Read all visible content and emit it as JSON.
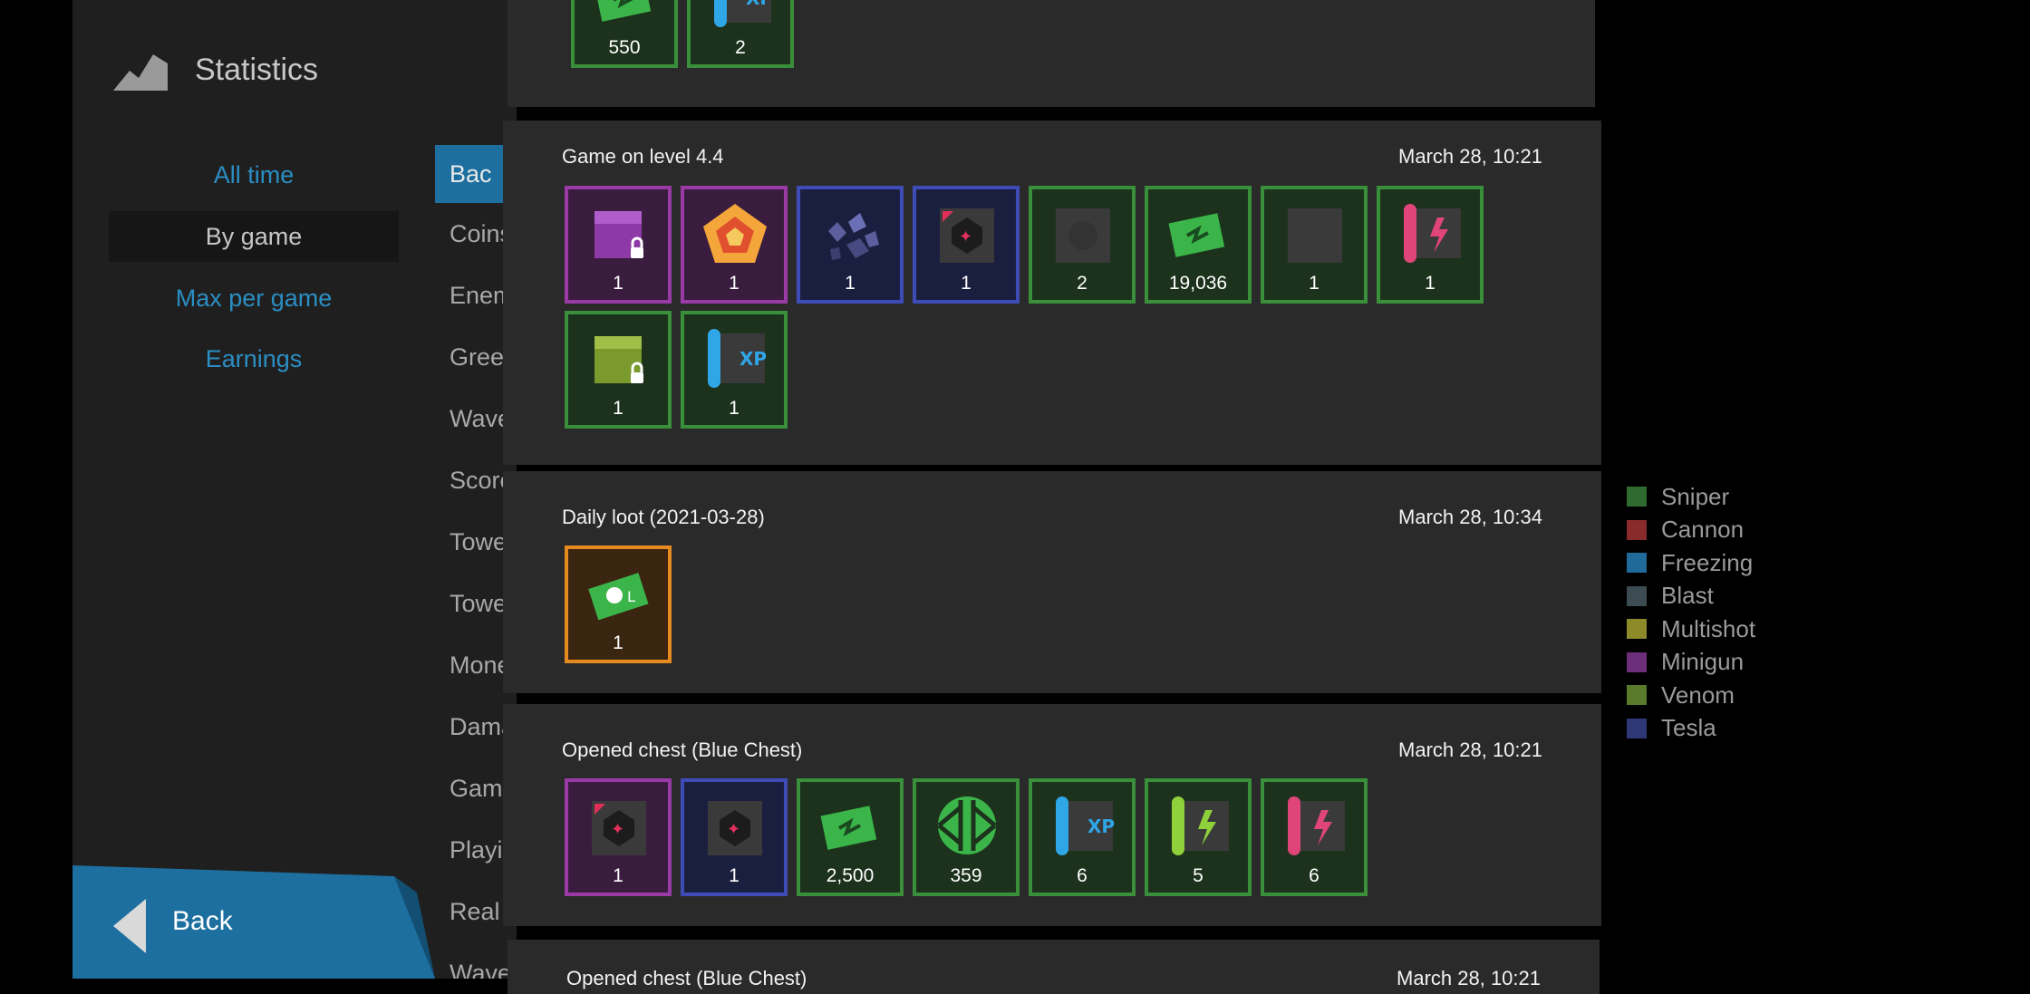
{
  "app": {
    "title": "Statistics"
  },
  "nav": [
    {
      "label": "All time",
      "active": false
    },
    {
      "label": "By game",
      "active": true
    },
    {
      "label": "Max per game",
      "active": false
    },
    {
      "label": "Earnings",
      "active": false
    }
  ],
  "list": [
    "Bac",
    "Coins",
    "Enem",
    "Green",
    "Wave",
    "Score c",
    "Towe",
    "Towe",
    "Mone",
    "Dama",
    "Game",
    "Playin",
    "Real p",
    "Wave"
  ],
  "back": {
    "label": "Back"
  },
  "cards": [
    {
      "title": "",
      "date": "",
      "items": [
        {
          "icon": "green-tickets-icon",
          "color": "green",
          "qty": "550"
        },
        {
          "icon": "xp-scroll-icon",
          "color": "green",
          "qty": "2"
        }
      ]
    },
    {
      "title": "Game on level 4.4",
      "date": "March 28, 10:21",
      "items": [
        {
          "icon": "purple-locked-chest-icon",
          "color": "purple",
          "qty": "1"
        },
        {
          "icon": "orange-pentagon-emblem-icon",
          "color": "purple",
          "qty": "1"
        },
        {
          "icon": "dark-crystals-icon",
          "color": "blue",
          "qty": "1"
        },
        {
          "icon": "research-token-icon",
          "color": "blue",
          "qty": "1"
        },
        {
          "icon": "gray-tile-icon",
          "color": "green",
          "qty": "2"
        },
        {
          "icon": "green-tickets-icon",
          "color": "green",
          "qty": "19,036"
        },
        {
          "icon": "gray-tile-icon",
          "color": "green",
          "qty": "1"
        },
        {
          "icon": "pink-scroll-icon",
          "color": "green",
          "qty": "1"
        },
        {
          "icon": "green-locked-chest-icon",
          "color": "green",
          "qty": "1"
        },
        {
          "icon": "xp-scroll-icon",
          "color": "green",
          "qty": "1"
        }
      ]
    },
    {
      "title": "Daily loot (2021-03-28)",
      "date": "March 28, 10:34",
      "items": [
        {
          "icon": "loot-ticket-icon",
          "color": "orange",
          "qty": "1"
        }
      ]
    },
    {
      "title": "Opened chest (Blue Chest)",
      "date": "March 28, 10:21",
      "items": [
        {
          "icon": "research-token-icon",
          "color": "purple",
          "qty": "1"
        },
        {
          "icon": "research-token-icon",
          "color": "blue",
          "qty": "1"
        },
        {
          "icon": "green-tickets-icon",
          "color": "green",
          "qty": "2,500"
        },
        {
          "icon": "green-emblem-icon",
          "color": "green",
          "qty": "359"
        },
        {
          "icon": "xp-scroll-icon",
          "color": "green",
          "qty": "6"
        },
        {
          "icon": "lime-scroll-icon",
          "color": "green",
          "qty": "5"
        },
        {
          "icon": "pink-scroll-icon",
          "color": "green",
          "qty": "6"
        }
      ]
    },
    {
      "title": "Opened chest (Blue Chest)",
      "date": "March 28, 10:21",
      "items": []
    }
  ],
  "legend": [
    {
      "label": "Sniper",
      "color": "#2f6b30"
    },
    {
      "label": "Cannon",
      "color": "#8a2b2b"
    },
    {
      "label": "Freezing",
      "color": "#1f6a99"
    },
    {
      "label": "Blast",
      "color": "#3d4b52"
    },
    {
      "label": "Multishot",
      "color": "#8d8a2a"
    },
    {
      "label": "Minigun",
      "color": "#6d2f7a"
    },
    {
      "label": "Venom",
      "color": "#5a7a2c"
    },
    {
      "label": "Tesla",
      "color": "#2f3777"
    }
  ]
}
